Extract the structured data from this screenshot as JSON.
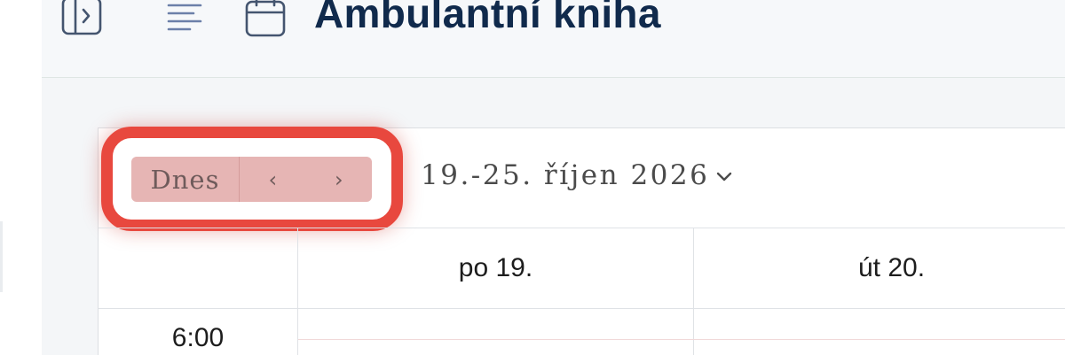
{
  "header": {
    "title": "Ambulantní kniha",
    "icons": [
      "sidebar-toggle-icon",
      "text-align-icon",
      "calendar-icon"
    ]
  },
  "toolbar": {
    "today_label": "Dnes",
    "prev_label": "‹",
    "next_label": "›",
    "date_range": "19.-25. říjen 2026",
    "highlight_color": "#e8483e",
    "highlight_fill": "#e6b5b4"
  },
  "grid": {
    "days": [
      "po 19.",
      "út 20."
    ],
    "times": [
      "6:00"
    ]
  },
  "colors": {
    "title": "#102a4c",
    "header_bg": "#f6f8fa",
    "content_bg": "#f4f6f8",
    "grid_line": "#dfe2e6"
  }
}
